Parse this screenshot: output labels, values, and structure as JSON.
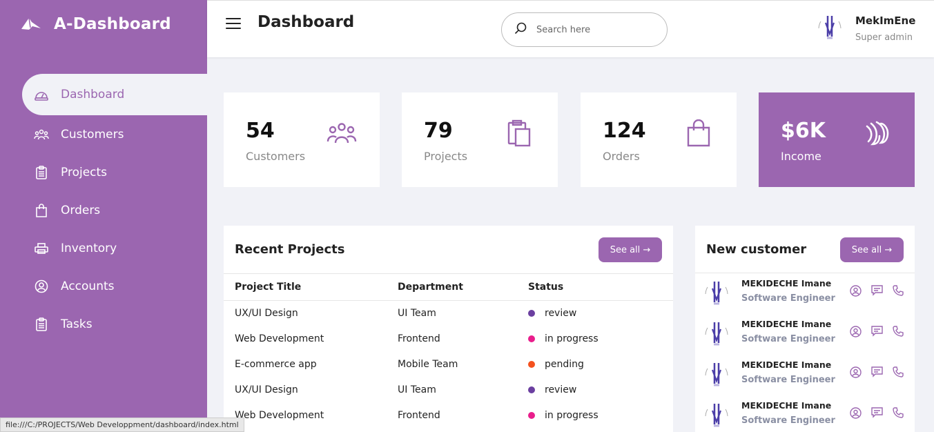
{
  "brand": {
    "name": "A-Dashboard"
  },
  "sidebar": {
    "items": [
      {
        "label": "Dashboard",
        "icon": "dashboard-gauge-icon",
        "active": true
      },
      {
        "label": "Customers",
        "icon": "users-icon"
      },
      {
        "label": "Projects",
        "icon": "clipboard-icon"
      },
      {
        "label": "Orders",
        "icon": "bag-icon"
      },
      {
        "label": "Inventory",
        "icon": "printer-icon"
      },
      {
        "label": "Accounts",
        "icon": "user-circle-icon"
      },
      {
        "label": "Tasks",
        "icon": "tasks-icon"
      }
    ]
  },
  "header": {
    "title": "Dashboard",
    "search_placeholder": "Search here",
    "user_name": "MekImEne",
    "user_role": "Super admin"
  },
  "cards": [
    {
      "value": "54",
      "label": "Customers",
      "icon": "users-icon"
    },
    {
      "value": "79",
      "label": "Projects",
      "icon": "clipboard-icon"
    },
    {
      "value": "124",
      "label": "Orders",
      "icon": "bag-icon"
    },
    {
      "value": "$6K",
      "label": "Income",
      "icon": "income-icon"
    }
  ],
  "recent_projects": {
    "title": "Recent Projects",
    "see_all": "See all →",
    "columns": [
      "Project Title",
      "Department",
      "Status"
    ],
    "rows": [
      {
        "title": "UX/UI Design",
        "dept": "UI Team",
        "status": "review",
        "color": "#6b3fa0"
      },
      {
        "title": "Web Development",
        "dept": "Frontend",
        "status": "in progress",
        "color": "#e91e8c"
      },
      {
        "title": "E-commerce app",
        "dept": "Mobile Team",
        "status": "pending",
        "color": "#f4511e"
      },
      {
        "title": "UX/UI Design",
        "dept": "UI Team",
        "status": "review",
        "color": "#6b3fa0"
      },
      {
        "title": "Web Development",
        "dept": "Frontend",
        "status": "in progress",
        "color": "#e91e8c"
      }
    ]
  },
  "new_customer": {
    "title": "New customer",
    "see_all": "See all →",
    "rows": [
      {
        "name": "MEKIDECHE Imane",
        "job": "Software Engineer"
      },
      {
        "name": "MEKIDECHE Imane",
        "job": "Software Engineer"
      },
      {
        "name": "MEKIDECHE Imane",
        "job": "Software Engineer"
      },
      {
        "name": "MEKIDECHE Imane",
        "job": "Software Engineer"
      }
    ]
  },
  "statusbar": {
    "url": "file:///C:/PROJECTS/Web Developpment/dashboard/index.html"
  },
  "colors": {
    "accent": "#9b66b0",
    "background": "#f1f2f7"
  }
}
